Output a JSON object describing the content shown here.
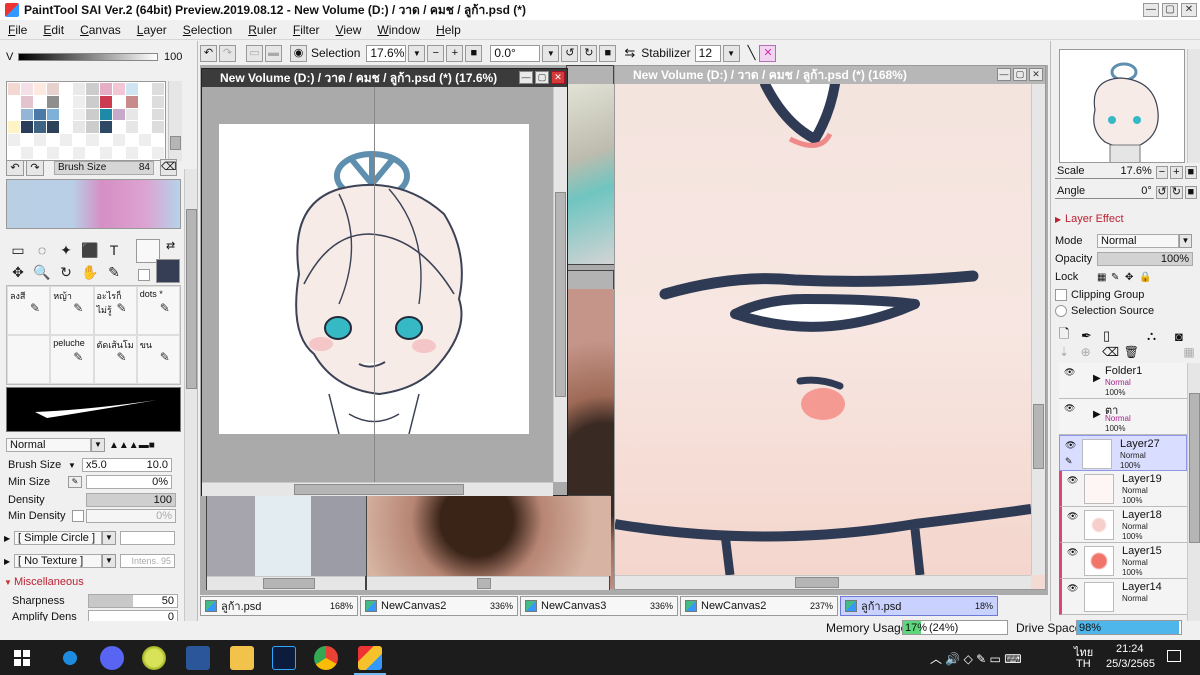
{
  "app": {
    "title": "PaintTool SAI Ver.2 (64bit) Preview.2019.08.12 - New Volume (D:) / วาด / คมช / ลูก้า.psd (*)"
  },
  "menu": [
    "File",
    "Edit",
    "Canvas",
    "Layer",
    "Selection",
    "Ruler",
    "Filter",
    "View",
    "Window",
    "Help"
  ],
  "left": {
    "v_label": "V",
    "v_value": "100",
    "brush_size_label": "Brush Size",
    "brush_size_value": "84",
    "tool_icons": [
      "▭",
      "◌",
      "✦",
      "⬛",
      "T",
      "✥",
      "🔍",
      "↻",
      "✋",
      "✎"
    ],
    "brushes": [
      {
        "name": "ลงสี"
      },
      {
        "name": "หญ้า"
      },
      {
        "name": "อะไรก็ไม่รู้"
      },
      {
        "name": "dots *"
      },
      {
        "name": ""
      },
      {
        "name": "peluche"
      },
      {
        "name": "ตัดเส้นโม"
      },
      {
        "name": "ขน"
      }
    ],
    "blend_mode": "Normal",
    "brush_size2_label": "Brush Size",
    "brush_size2_multiplier": "x5.0",
    "brush_size2_value": "10.0",
    "min_size_label": "Min Size",
    "min_size_value": "0%",
    "density_label": "Density",
    "density_value": "100",
    "min_density_label": "Min Density",
    "min_density_value": "0%",
    "shape": "[ Simple Circle ]",
    "texture": "[ No Texture ]",
    "texture_intens": "Intens. 95",
    "misc_header": "Miscellaneous",
    "sharpness_label": "Sharpness",
    "sharpness_value": "50",
    "amplify_label": "Amplify Dens",
    "amplify_value": "0"
  },
  "toolbar": {
    "selection_label": "Selection",
    "zoom_value": "17.6%",
    "angle_value": "0.0°",
    "stabilizer_label": "Stabilizer",
    "stabilizer_value": "12"
  },
  "windows": {
    "small": {
      "title": "New Volume (D:) / วาด / คมช / ลูก้า.psd (*) (17.6%)"
    },
    "large": {
      "title": "New Volume (D:) / วาด / คมช / ลูก้า.psd (*) (168%)"
    }
  },
  "right": {
    "scale_label": "Scale",
    "scale_value": "17.6%",
    "angle_label": "Angle",
    "angle_value": "0°",
    "layer_effect_header": "Layer Effect",
    "mode_label": "Mode",
    "mode_value": "Normal",
    "opacity_label": "Opacity",
    "opacity_value": "100%",
    "lock_label": "Lock",
    "clipping_group_label": "Clipping Group",
    "selection_source_label": "Selection Source",
    "layers": [
      {
        "name": "Folder1",
        "mode": "Normal",
        "opacity": "100%"
      },
      {
        "name": "ตา",
        "mode": "Normal",
        "opacity": "100%"
      },
      {
        "name": "Layer27",
        "mode": "Normal",
        "opacity": "100%"
      },
      {
        "name": "Layer19",
        "mode": "Normal",
        "opacity": "100%"
      },
      {
        "name": "Layer18",
        "mode": "Normal",
        "opacity": "100%"
      },
      {
        "name": "Layer15",
        "mode": "Normal",
        "opacity": "100%"
      },
      {
        "name": "Layer14",
        "mode": "Normal",
        "opacity": ""
      }
    ]
  },
  "doc_tabs": [
    {
      "name": "ลูก้า.psd",
      "zoom": "168%"
    },
    {
      "name": "NewCanvas2",
      "zoom": "336%"
    },
    {
      "name": "NewCanvas3",
      "zoom": "336%"
    },
    {
      "name": "NewCanvas2",
      "zoom": "237%"
    },
    {
      "name": "ลูก้า.psd",
      "zoom": "18%"
    }
  ],
  "status": {
    "memory_label": "Memory Usage",
    "memory_value": "17%",
    "memory_paren": "(24%)",
    "memory_fraction": 0.17,
    "drive_label": "Drive Space",
    "drive_value": "98%",
    "drive_fraction": 0.98
  },
  "taskbar": {
    "lang_top": "ไทย",
    "lang_bottom": "TH",
    "time": "21:24",
    "date": "25/3/2565"
  }
}
